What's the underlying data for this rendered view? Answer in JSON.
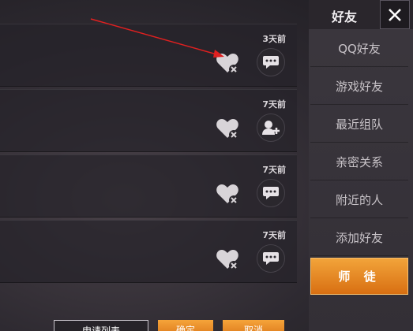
{
  "rows": [
    {
      "time": "3天前",
      "action_icon": "chat-icon"
    },
    {
      "time": "7天前",
      "action_icon": "add-friend-icon"
    },
    {
      "time": "7天前",
      "action_icon": "chat-icon"
    },
    {
      "time": "7天前",
      "action_icon": "chat-icon"
    }
  ],
  "sidebar": {
    "title": "好友",
    "tabs": [
      "QQ好友",
      "游戏好友",
      "最近组队",
      "亲密关系",
      "附近的人",
      "添加好友"
    ],
    "active_tab": "师 徒"
  },
  "bottom": {
    "btn1": "申请列表",
    "btn2": "确定",
    "btn3": "取消"
  },
  "colors": {
    "accent": "#e8891f",
    "annotation_arrow": "#e02020"
  }
}
